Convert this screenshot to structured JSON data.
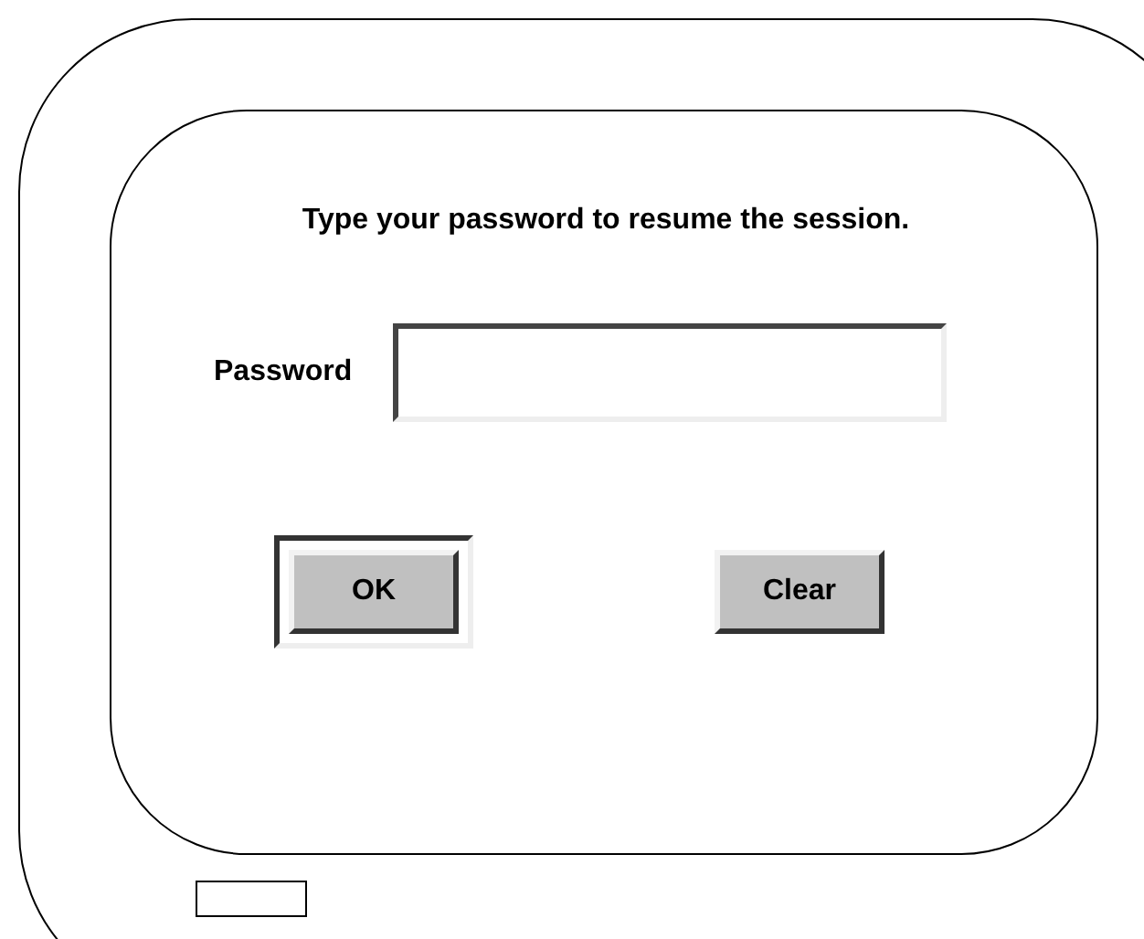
{
  "prompt": "Type your password to resume the session.",
  "password": {
    "label": "Password"
  },
  "buttons": [
    {
      "label": "OK",
      "default": true
    },
    {
      "label": "Clear",
      "default": false
    }
  ]
}
